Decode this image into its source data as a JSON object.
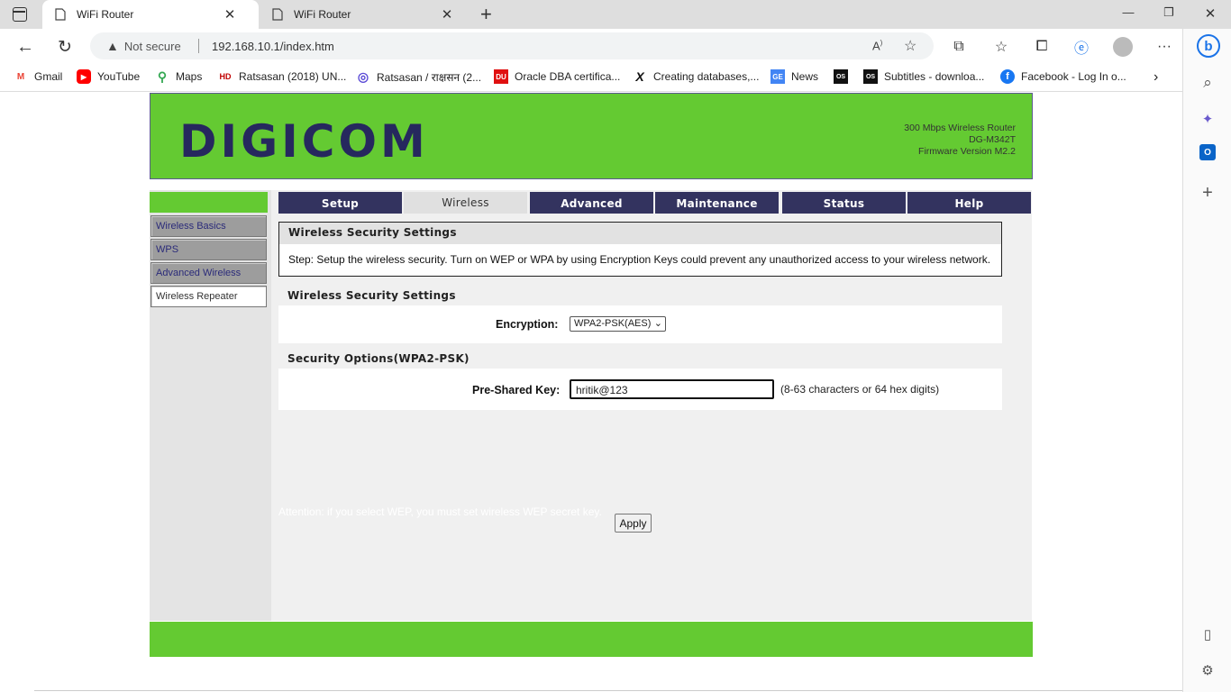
{
  "browser": {
    "tabs": [
      {
        "title": "WiFi Router",
        "active": true
      },
      {
        "title": "WiFi Router",
        "active": false
      }
    ],
    "security_label": "Not secure",
    "url": "192.168.10.1/index.htm",
    "bookmarks": [
      {
        "label": "Gmail",
        "icon": "gmail-icon",
        "color": "#ea4335",
        "glyph": "M"
      },
      {
        "label": "YouTube",
        "icon": "youtube-icon",
        "color": "#ff0000",
        "glyph": "▶"
      },
      {
        "label": "Maps",
        "icon": "maps-icon",
        "color": "#34a853",
        "glyph": "⬤"
      },
      {
        "label": "Ratsasan (2018) UN...",
        "icon": "hd-icon",
        "color": "#c00000",
        "glyph": "HD"
      },
      {
        "label": "Ratsasan / राक्षसन (2...",
        "icon": "web-icon",
        "color": "#5b4bd6",
        "glyph": "◎"
      },
      {
        "label": "Oracle DBA certifica...",
        "icon": "du-icon",
        "color": "#e01010",
        "glyph": "DU"
      },
      {
        "label": "Creating databases,...",
        "icon": "x-icon",
        "color": "#111111",
        "glyph": "X"
      },
      {
        "label": "News",
        "icon": "news-icon",
        "color": "#4285f4",
        "glyph": "GE"
      },
      {
        "label": "",
        "icon": "os-icon",
        "color": "#111111",
        "glyph": "OS"
      },
      {
        "label": "Subtitles - downloa...",
        "icon": "os-icon",
        "color": "#111111",
        "glyph": "OS"
      },
      {
        "label": "Facebook - Log In o...",
        "icon": "facebook-icon",
        "color": "#1877f2",
        "glyph": "f"
      }
    ]
  },
  "router": {
    "logo": "DIGICOM",
    "product_lines": [
      "300 Mbps Wireless Router",
      "DG-M342T",
      "Firmware Version M2.2"
    ],
    "side_menu": [
      {
        "label": "Wireless Basics",
        "selected": false
      },
      {
        "label": "WPS",
        "selected": false
      },
      {
        "label": "Advanced Wireless",
        "selected": false
      },
      {
        "label": "Wireless Repeater",
        "selected": true
      }
    ],
    "nav_tabs": [
      {
        "label": "Setup",
        "active": false
      },
      {
        "label": "Wireless",
        "active": true
      },
      {
        "label": "Advanced",
        "active": false
      },
      {
        "label": "Maintenance",
        "active": false
      },
      {
        "label": "Status",
        "active": false
      },
      {
        "label": "Help",
        "active": false
      }
    ],
    "info_title": "Wireless Security Settings",
    "info_text": "Step: Setup the wireless security. Turn on WEP or WPA by using Encryption Keys could prevent any unauthorized access to your wireless network.",
    "section1_title": "Wireless Security Settings",
    "encryption_label": "Encryption:",
    "encryption_value": "WPA2-PSK(AES)",
    "section2_title": "Security Options(WPA2-PSK)",
    "psk_label": "Pre-Shared Key:",
    "psk_value": "hritik@123",
    "psk_hint": "(8-63 characters or 64 hex digits)",
    "attention": "Attention: if you select WEP, you must set wireless WEP secret key.",
    "apply_label": "Apply"
  },
  "colors": {
    "brand_green": "#64ca32",
    "brand_navy": "#33335f"
  }
}
